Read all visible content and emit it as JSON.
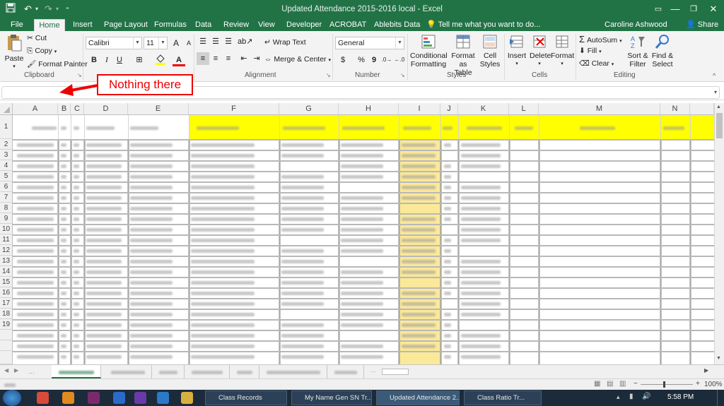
{
  "window": {
    "title": "Updated Attendance 2015-2016 local - Excel",
    "colors": {
      "accent": "#217346",
      "highlight": "#ffff00",
      "callout": "#e00000"
    }
  },
  "quick_access": {
    "save_icon": "save-icon",
    "undo_icon": "undo-icon",
    "redo_icon": "redo-icon"
  },
  "tabs": [
    "File",
    "Home",
    "Insert",
    "Page Layout",
    "Formulas",
    "Data",
    "Review",
    "View",
    "Developer",
    "ACROBAT",
    "Ablebits Data"
  ],
  "tell_me": "Tell me what you want to do...",
  "user": "Caroline Ashwood",
  "share": "Share",
  "ribbon": {
    "clipboard": {
      "paste": "Paste",
      "cut": "Cut",
      "copy": "Copy",
      "format_painter": "Format Painter",
      "label": "Clipboard"
    },
    "font": {
      "name": "Calibri",
      "size": "11",
      "bold": "B",
      "italic": "I",
      "underline": "U",
      "font_color": "A",
      "increase": "A",
      "decrease": "A"
    },
    "alignment": {
      "wrap": "Wrap Text",
      "merge": "Merge & Center",
      "label": "Alignment"
    },
    "number": {
      "format": "General",
      "currency": "$",
      "percent": "%",
      "comma": "9",
      "label": "Number"
    },
    "styles": {
      "conditional_1": "Conditional",
      "conditional_2": "Formatting",
      "format_as_1": "Format as",
      "format_as_2": "Table",
      "cell_1": "Cell",
      "cell_2": "Styles",
      "label": "Styles"
    },
    "cells": {
      "insert": "Insert",
      "delete": "Delete",
      "format": "Format",
      "label": "Cells"
    },
    "editing": {
      "autosum": "AutoSum",
      "fill": "Fill",
      "clear": "Clear",
      "sort_1": "Sort &",
      "sort_2": "Filter",
      "find_1": "Find &",
      "find_2": "Select",
      "label": "Editing"
    }
  },
  "callout": "Nothing there",
  "columns": [
    "A",
    "B",
    "C",
    "D",
    "E",
    "F",
    "G",
    "H",
    "I",
    "J",
    "K",
    "L",
    "M",
    "N"
  ],
  "rows": [
    "1",
    "2",
    "3",
    "4",
    "5",
    "6",
    "7",
    "8",
    "9",
    "10",
    "11",
    "12",
    "13",
    "14",
    "15",
    "16",
    "17",
    "18",
    "19"
  ],
  "status": {
    "zoom": "100%",
    "clock": "5:58 PM"
  },
  "taskbar_items": [
    "Class Records",
    "My Name Gen SN Tr...",
    "Updated Attendance 2...",
    "Class Ratio Tr..."
  ]
}
